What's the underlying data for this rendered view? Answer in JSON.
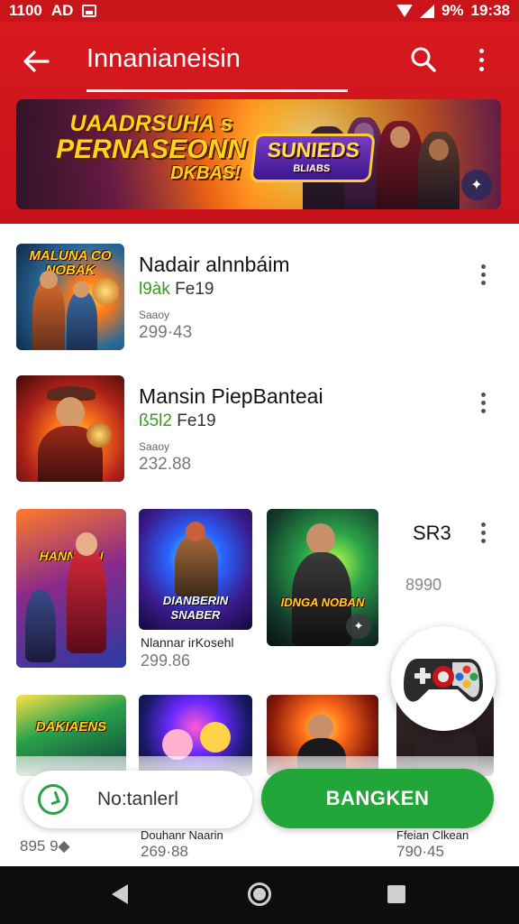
{
  "status_bar": {
    "time_left": "1100",
    "app_glyph": "AD",
    "battery": "9%",
    "time_right": "19:38"
  },
  "app_bar": {
    "title": "Innanianeisin"
  },
  "banner": {
    "line1": "UAADRSUHA s",
    "line2": "PERNASEONN",
    "line3": "DKBAS!",
    "logo": "SUNIEDS",
    "logo_sub": "BLIABS"
  },
  "list": [
    {
      "name": "Nadair alnnbáim",
      "rating": "l9àk",
      "rating_suffix": "Fe19",
      "label": "Saaoy",
      "price": "299·43",
      "art_caption": "MALUNA CO NOBAK"
    },
    {
      "name": "Mansin PiepBanteai",
      "rating": "ß5l2",
      "rating_suffix": "Fe19",
      "label": "Saaoy",
      "price": "232.88",
      "art_caption": ""
    }
  ],
  "grid": {
    "tile1_caption": "HANNDAN",
    "tile2_caption": "DIANBERIN SNABER",
    "tile3_caption": "IDNGA NOBAN",
    "caption": "Nlannar irKosehl",
    "price": "299.86",
    "side_label": "SR3",
    "side_price": "8990"
  },
  "row3_captions": {
    "tile1": "DAKIAENS"
  },
  "bottom_bar": {
    "chip_label": "No:tanlerl",
    "cta_label": "BANGKEN"
  },
  "bottom_strip": {
    "left_text": "895 9◆",
    "mid_caption": "Douhanr Naarin",
    "mid_price": "269·88",
    "right_caption": "Ffeian Clkean",
    "right_price": "790·45"
  },
  "colors": {
    "brand_red": "#d7191f",
    "accent_green": "#22a63a",
    "rating_green": "#3a9a22"
  }
}
